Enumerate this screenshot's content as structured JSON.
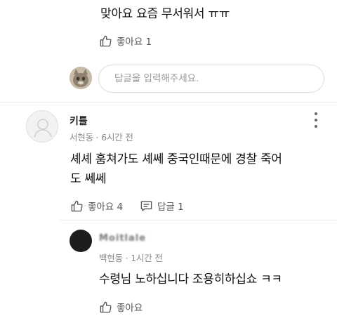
{
  "top_reply": {
    "text": "맞아요 요즘 무서워서 ㅠㅠ",
    "like_label": "좋아요 1"
  },
  "reply_input": {
    "placeholder": "답글을 입력해주세요."
  },
  "comment": {
    "nickname": "키틀",
    "meta": "서현동 · 6시간 전",
    "text_line1": "셰셰 훔쳐가도 셰쎄 중국인때문에 경찰 죽어",
    "text_line2": "도 쎄쎄",
    "like_label": "좋아요 4",
    "reply_label": "답글 1"
  },
  "nested_reply": {
    "nickname": "Moitlale",
    "meta": "백현동 · 1시간 전",
    "text": "수령님 노하십니다 조용히하십쇼 ㅋㅋ",
    "like_label": "좋아요"
  },
  "icons": {
    "like": "thumbs-up-icon",
    "reply": "speech-bubble-icon",
    "more": "more-vertical-icon",
    "avatar_default": "default-avatar-icon"
  },
  "colors": {
    "text": "#111111",
    "meta": "#8a8a8a",
    "action": "#555555"
  }
}
